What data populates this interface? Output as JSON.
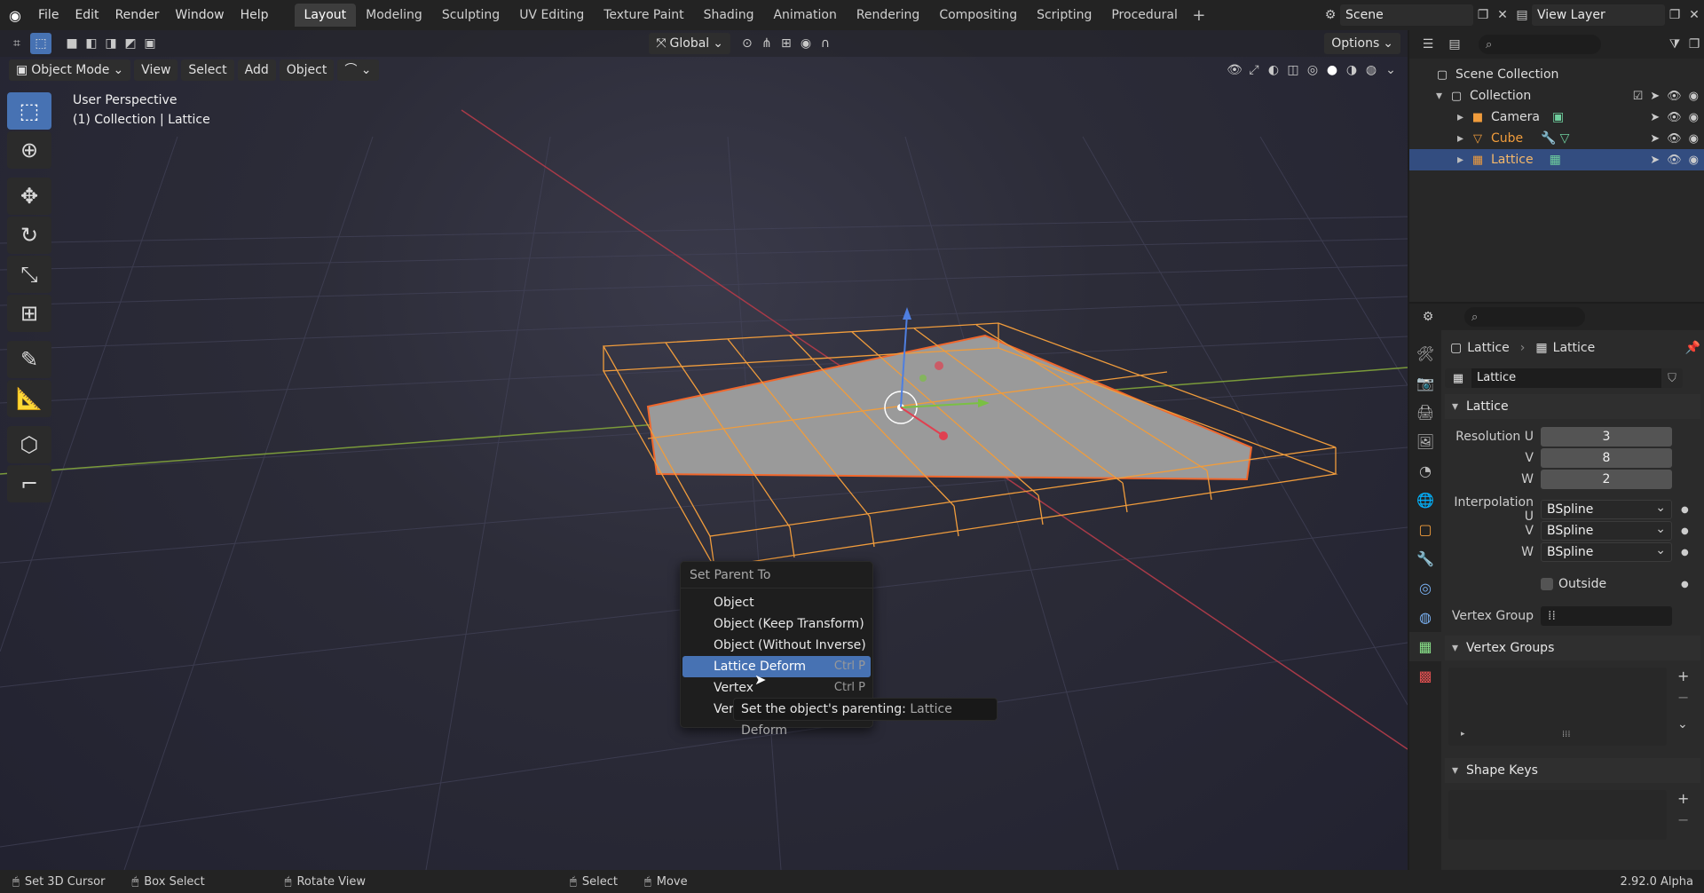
{
  "topbar": {
    "menus": [
      "File",
      "Edit",
      "Render",
      "Window",
      "Help"
    ],
    "workspaces": [
      "Layout",
      "Modeling",
      "Sculpting",
      "UV Editing",
      "Texture Paint",
      "Shading",
      "Animation",
      "Rendering",
      "Compositing",
      "Scripting",
      "Procedural"
    ],
    "active_workspace": "Layout",
    "scene": "Scene",
    "view_layer": "View Layer"
  },
  "vp_header": {
    "mode": "Object Mode",
    "menus": [
      "View",
      "Select",
      "Add",
      "Object"
    ],
    "transform_orientation": "Global",
    "options": "Options"
  },
  "viewport": {
    "perspective": "User Perspective",
    "collection_info": "(1) Collection | Lattice"
  },
  "context_menu": {
    "title": "Set Parent To",
    "items": [
      {
        "label": "Object",
        "shortcut": ""
      },
      {
        "label": "Object (Keep Transform)",
        "shortcut": ""
      },
      {
        "label": "Object (Without Inverse)",
        "shortcut": ""
      },
      {
        "label": "Lattice Deform",
        "shortcut": "Ctrl P"
      },
      {
        "label": "Vertex",
        "shortcut": "Ctrl P"
      },
      {
        "label": "Ver",
        "shortcut": ""
      }
    ],
    "highlighted_index": 3
  },
  "tooltip": {
    "prefix": "Set the object's parenting:",
    "value": "Lattice Deform"
  },
  "outliner": {
    "root": "Scene Collection",
    "collection": "Collection",
    "objects": [
      {
        "name": "Camera",
        "color": "#e6e6e6",
        "selected": false
      },
      {
        "name": "Cube",
        "color": "#f09c3c",
        "selected": false
      },
      {
        "name": "Lattice",
        "color": "#f5b86a",
        "selected": true
      }
    ]
  },
  "properties": {
    "breadcrumb_object": "Lattice",
    "breadcrumb_data": "Lattice",
    "datablock_name": "Lattice",
    "panel_lattice": "Lattice",
    "resolution": {
      "label_u": "Resolution U",
      "u": "3",
      "label_v": "V",
      "v": "8",
      "label_w": "W",
      "w": "2"
    },
    "interpolation": {
      "label_u": "Interpolation U",
      "u": "BSpline",
      "label_v": "V",
      "v": "BSpline",
      "label_w": "W",
      "w": "BSpline"
    },
    "outside_label": "Outside",
    "vertex_group_label": "Vertex Group",
    "panel_vertex_groups": "Vertex Groups",
    "panel_shape_keys": "Shape Keys"
  },
  "status": {
    "items": [
      "Set 3D Cursor",
      "Box Select",
      "Rotate View",
      "Select",
      "Move"
    ],
    "version": "2.92.0 Alpha"
  },
  "colors": {
    "accent": "#4772b3",
    "lattice_orange": "#f09c3c",
    "selected_row": "#334d80"
  }
}
